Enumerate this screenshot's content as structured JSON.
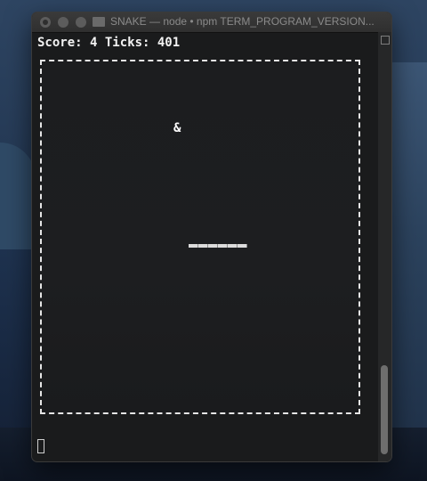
{
  "window": {
    "title": "SNAKE — node • npm TERM_PROGRAM_VERSION..."
  },
  "game": {
    "status_line": "Score: 4 Ticks: 401",
    "food_glyph": "&"
  },
  "colors": {
    "terminal_bg": "#1a1b1c",
    "text": "#f2f2f2",
    "border": "#e6e6e6"
  },
  "icons": {
    "close": "close-icon",
    "minimize": "minimize-icon",
    "maximize": "maximize-icon",
    "folder": "folder-icon",
    "scroll_menu": "scroll-menu-icon"
  },
  "scroll": {
    "position_fraction": 1.0
  }
}
